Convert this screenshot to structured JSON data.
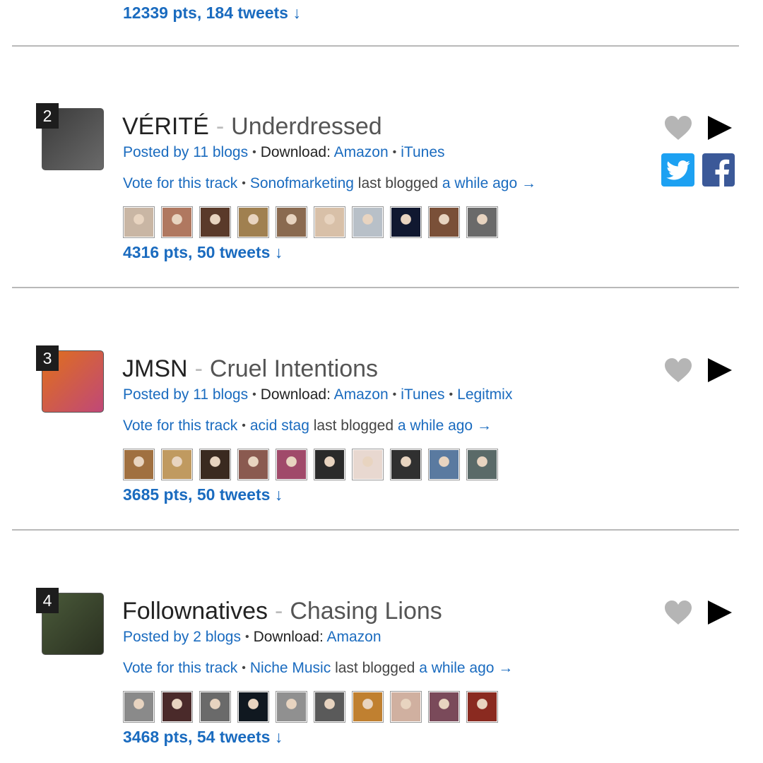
{
  "top": {
    "pts": "12339 pts, 184 tweets ↓"
  },
  "tracks": [
    {
      "rank": "2",
      "artist": "VÉRITÉ",
      "separator": "-",
      "title": "Underdressed",
      "posted_by": "Posted by 11 blogs",
      "download_label": "Download:",
      "stores": [
        "Amazon",
        "iTunes"
      ],
      "vote": "Vote for this track",
      "blogger": "Sonofmarketing",
      "last_blogged": "last blogged",
      "time": "a while ago →",
      "pts": "4316 pts, 50 tweets ↓",
      "show_share": true,
      "icons": {
        "heart": "heart-icon",
        "play": "play-icon",
        "twitter": "twitter-icon",
        "facebook": "facebook-icon"
      },
      "thumb_colors": [
        "#3a3a3a",
        "#6a6a6a"
      ],
      "avatar_colors": [
        "#c9b6a4",
        "#b07860",
        "#5a3a2a",
        "#a08050",
        "#8a6a50",
        "#d8c0a8",
        "#b8c0c8",
        "#101830",
        "#7a5038",
        "#6a6a6a"
      ]
    },
    {
      "rank": "3",
      "artist": "JMSN",
      "separator": "-",
      "title": "Cruel Intentions",
      "posted_by": "Posted by 11 blogs",
      "download_label": "Download:",
      "stores": [
        "Amazon",
        "iTunes",
        "Legitmix"
      ],
      "vote": "Vote for this track",
      "blogger": "acid stag",
      "last_blogged": "last blogged",
      "time": "a while ago →",
      "pts": "3685 pts, 50 tweets ↓",
      "show_share": false,
      "icons": {
        "heart": "heart-icon",
        "play": "play-icon"
      },
      "thumb_colors": [
        "#e0701a",
        "#c04878"
      ],
      "avatar_colors": [
        "#a07040",
        "#c09a60",
        "#3a2a20",
        "#8a5a50",
        "#a04a6a",
        "#2a2a2a",
        "#e8d8d0",
        "#303030",
        "#5a7aa0",
        "#5a6a68"
      ]
    },
    {
      "rank": "4",
      "artist": "Follownatives",
      "separator": "-",
      "title": "Chasing Lions",
      "posted_by": "Posted by 2 blogs",
      "download_label": "Download:",
      "stores": [
        "Amazon"
      ],
      "vote": "Vote for this track",
      "blogger": "Niche Music",
      "last_blogged": "last blogged",
      "time": "a while ago →",
      "pts": "3468 pts, 54 tweets ↓",
      "show_share": false,
      "icons": {
        "heart": "heart-icon",
        "play": "play-icon"
      },
      "thumb_colors": [
        "#4a5a3a",
        "#2a3020"
      ],
      "avatar_colors": [
        "#8a8a8a",
        "#4a2a2a",
        "#6a6a6a",
        "#101820",
        "#909090",
        "#5a5a5a",
        "#c08030",
        "#d0b0a0",
        "#7a4a5a",
        "#8a2a20"
      ]
    }
  ],
  "colors": {
    "link": "#1a6bbf",
    "heart": "#b5b5b5",
    "twitter": "#1da1f2",
    "facebook": "#3b5998"
  }
}
